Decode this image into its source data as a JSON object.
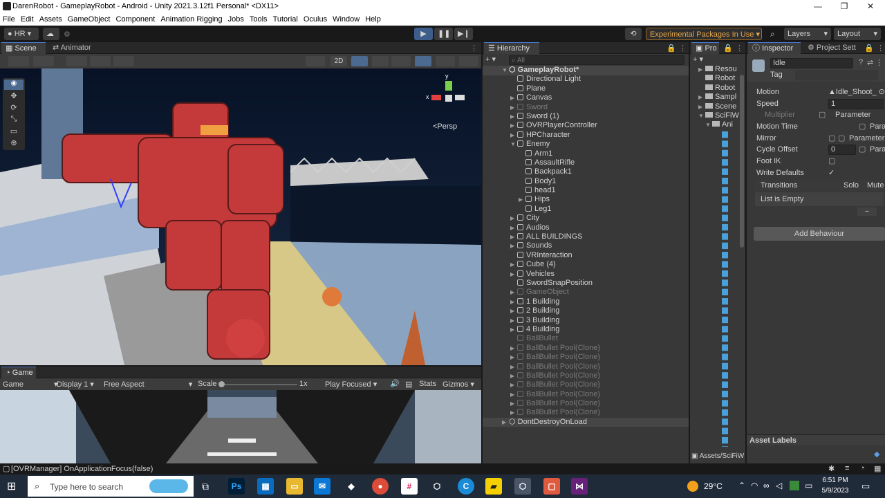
{
  "window": {
    "title": "DarenRobot - GameplayRobot - Android - Unity 2021.3.12f1 Personal* <DX11>"
  },
  "menu": [
    "File",
    "Edit",
    "Assets",
    "GameObject",
    "Component",
    "Animation Rigging",
    "Jobs",
    "Tools",
    "Tutorial",
    "Oculus",
    "Window",
    "Help"
  ],
  "toolbar": {
    "account": "HR",
    "experimental": "Experimental Packages In Use",
    "layers": "Layers",
    "layout": "Layout"
  },
  "scene_tabs": {
    "scene": "Scene",
    "animator": "Animator"
  },
  "scene": {
    "view_2d": "2D",
    "persp": "<Persp",
    "gizmo_x": "x",
    "gizmo_y": "y"
  },
  "game": {
    "tab": "Game",
    "mode": "Game",
    "display": "Display 1",
    "aspect": "Free Aspect",
    "scale_label": "Scale",
    "scale_value": "1x",
    "play_focused": "Play Focused",
    "stats": "Stats",
    "gizmos": "Gizmos"
  },
  "hierarchy": {
    "title": "Hierarchy",
    "search_placeholder": "All",
    "items": [
      {
        "label": "GameplayRobot*",
        "dim": false
      },
      {
        "label": "Directional Light",
        "dim": false
      },
      {
        "label": "Plane",
        "dim": false
      },
      {
        "label": "Canvas",
        "dim": false
      },
      {
        "label": "Sword",
        "dim": true
      },
      {
        "label": "Sword (1)",
        "dim": false
      },
      {
        "label": "OVRPlayerController",
        "dim": false
      },
      {
        "label": "HPCharacter",
        "dim": false
      },
      {
        "label": "Enemy",
        "dim": false
      },
      {
        "label": "Arm1",
        "dim": false
      },
      {
        "label": "AssaultRifle",
        "dim": false
      },
      {
        "label": "Backpack1",
        "dim": false
      },
      {
        "label": "Body1",
        "dim": false
      },
      {
        "label": "head1",
        "dim": false
      },
      {
        "label": "Hips",
        "dim": false
      },
      {
        "label": "Leg1",
        "dim": false
      },
      {
        "label": "City",
        "dim": false
      },
      {
        "label": "Audios",
        "dim": false
      },
      {
        "label": "ALL BUILDINGS",
        "dim": false
      },
      {
        "label": "Sounds",
        "dim": false
      },
      {
        "label": "VRInteraction",
        "dim": false
      },
      {
        "label": "Cube (4)",
        "dim": false
      },
      {
        "label": "Vehicles",
        "dim": false
      },
      {
        "label": "SwordSnapPosition",
        "dim": false
      },
      {
        "label": "GameObject",
        "dim": true
      },
      {
        "label": "1 Building",
        "dim": false
      },
      {
        "label": "2 Building",
        "dim": false
      },
      {
        "label": "3 Building",
        "dim": false
      },
      {
        "label": "4 Building",
        "dim": false
      },
      {
        "label": "BallBullet",
        "dim": true
      },
      {
        "label": "BallBullet Pool(Clone)",
        "dim": true
      },
      {
        "label": "BallBullet Pool(Clone)",
        "dim": true
      },
      {
        "label": "BallBullet Pool(Clone)",
        "dim": true
      },
      {
        "label": "BallBullet Pool(Clone)",
        "dim": true
      },
      {
        "label": "BallBullet Pool(Clone)",
        "dim": true
      },
      {
        "label": "BallBullet Pool(Clone)",
        "dim": true
      },
      {
        "label": "BallBullet Pool(Clone)",
        "dim": true
      },
      {
        "label": "BallBullet Pool(Clone)",
        "dim": true
      },
      {
        "label": "DontDestroyOnLoad",
        "dim": false
      }
    ]
  },
  "project": {
    "tab": "Pro",
    "folders": [
      "Resou",
      "Robot",
      "Robot",
      "Sampl",
      "Scene",
      "SciFiW",
      "Ani"
    ],
    "path": "Assets/SciFiW"
  },
  "inspector": {
    "tab": "Inspector",
    "tab2": "Project Sett",
    "name": "Idle",
    "tag_label": "Tag",
    "fields": {
      "motion_label": "Motion",
      "motion_value": "Idle_Shoot_",
      "speed_label": "Speed",
      "speed_value": "1",
      "multiplier_label": "Multiplier",
      "multiplier_value": "Parameter",
      "motion_time_label": "Motion Time",
      "motion_time_value": "Para",
      "mirror_label": "Mirror",
      "mirror_value": "Parameter",
      "cycle_offset_label": "Cycle Offset",
      "cycle_offset_value": "0",
      "cycle_offset_param": "Para",
      "foot_ik_label": "Foot IK",
      "write_defaults_label": "Write Defaults"
    },
    "transitions_label": "Transitions",
    "solo_label": "Solo",
    "mute_label": "Mute",
    "list_empty": "List is Empty",
    "add_behaviour": "Add Behaviour",
    "asset_labels": "Asset Labels"
  },
  "status": {
    "message": "[OVRManager] OnApplicationFocus(false)"
  },
  "taskbar": {
    "search_placeholder": "Type here to search",
    "temperature": "29°C",
    "time": "6:51 PM",
    "date": "5/9/2023"
  }
}
